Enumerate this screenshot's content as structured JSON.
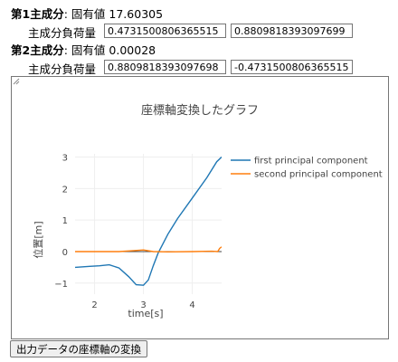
{
  "pc1": {
    "header": "第1主成分",
    "separator": ":",
    "eigen_label": "固有値",
    "eigen_value": "17.60305",
    "loading_label": "主成分負荷量",
    "loading_1": "0.4731500806365515",
    "loading_2": "0.8809818393097699"
  },
  "pc2": {
    "header": "第2主成分",
    "separator": ":",
    "eigen_label": "固有値",
    "eigen_value": "0.00028",
    "loading_label": "主成分負荷量",
    "loading_1": "0.8809818393097698",
    "loading_2": "-0.4731500806365515"
  },
  "convert_button": "出力データの座標軸の変換",
  "chart_data": {
    "type": "line",
    "title": "座標軸変換したグラフ",
    "xlabel": "time[s]",
    "ylabel": "位置[m]",
    "xlim": [
      1.6,
      4.6
    ],
    "ylim": [
      -1.35,
      3.1
    ],
    "x_ticks": [
      2,
      3,
      4
    ],
    "y_ticks": [
      -1,
      0,
      1,
      2,
      3
    ],
    "grid": true,
    "legend_position": "right",
    "series": [
      {
        "name": "first principal component",
        "color": "#1f77b4",
        "x": [
          1.6,
          1.9,
          2.1,
          2.3,
          2.5,
          2.7,
          2.85,
          3.0,
          3.1,
          3.2,
          3.3,
          3.5,
          3.7,
          4.0,
          4.3,
          4.5,
          4.6
        ],
        "y": [
          -0.5,
          -0.47,
          -0.45,
          -0.42,
          -0.52,
          -0.8,
          -1.05,
          -1.07,
          -0.9,
          -0.45,
          -0.05,
          0.55,
          1.05,
          1.7,
          2.35,
          2.85,
          3.0
        ]
      },
      {
        "name": "second principal component",
        "color": "#ff7f0e",
        "x": [
          1.6,
          2.0,
          2.5,
          2.8,
          3.0,
          3.2,
          3.5,
          4.0,
          4.4,
          4.52,
          4.56,
          4.6
        ],
        "y": [
          0.0,
          0.0,
          0.0,
          0.03,
          0.05,
          0.0,
          -0.01,
          0.0,
          0.01,
          0.0,
          0.1,
          0.15
        ]
      }
    ]
  }
}
